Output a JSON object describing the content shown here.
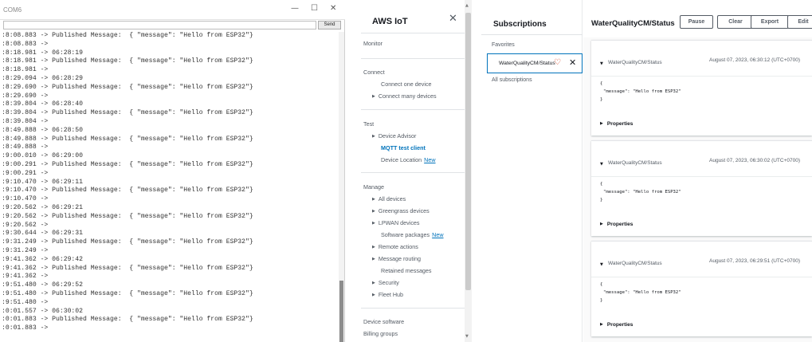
{
  "serial_monitor": {
    "title": "COM6",
    "send_label": "Send",
    "window_controls": [
      "—",
      "☐",
      "✕"
    ],
    "lines": [
      ":8:08.883 -> Published Message:  { \"message\": \"Hello from ESP32\"}",
      ":8:08.883 ->",
      ":8:18.981 -> 06:28:19",
      ":8:18.981 -> Published Message:  { \"message\": \"Hello from ESP32\"}",
      ":8:18.981 ->",
      ":8:29.094 -> 06:28:29",
      ":8:29.690 -> Published Message:  { \"message\": \"Hello from ESP32\"}",
      ":8:29.690 ->",
      ":8:39.804 -> 06:28:40",
      ":8:39.804 -> Published Message:  { \"message\": \"Hello from ESP32\"}",
      ":8:39.804 ->",
      ":8:49.888 -> 06:28:50",
      ":8:49.888 -> Published Message:  { \"message\": \"Hello from ESP32\"}",
      ":8:49.888 ->",
      ":9:00.010 -> 06:29:00",
      ":9:00.291 -> Published Message:  { \"message\": \"Hello from ESP32\"}",
      ":9:00.291 ->",
      ":9:10.470 -> 06:29:11",
      ":9:10.470 -> Published Message:  { \"message\": \"Hello from ESP32\"}",
      ":9:10.470 ->",
      ":9:20.562 -> 06:29:21",
      ":9:20.562 -> Published Message:  { \"message\": \"Hello from ESP32\"}",
      ":9:20.562 ->",
      ":9:30.644 -> 06:29:31",
      ":9:31.249 -> Published Message:  { \"message\": \"Hello from ESP32\"}",
      ":9:31.249 ->",
      ":9:41.362 -> 06:29:42",
      ":9:41.362 -> Published Message:  { \"message\": \"Hello from ESP32\"}",
      ":9:41.362 ->",
      ":9:51.480 -> 06:29:52",
      ":9:51.480 -> Published Message:  { \"message\": \"Hello from ESP32\"}",
      ":9:51.480 ->",
      ":0:01.557 -> 06:30:02",
      ":0:01.883 -> Published Message:  { \"message\": \"Hello from ESP32\"}",
      ":0:01.883 ->"
    ]
  },
  "nav": {
    "title": "AWS IoT",
    "close_icon": "✕",
    "monitor": "Monitor",
    "connect": {
      "heading": "Connect",
      "connect_one_device": "Connect one device",
      "connect_many_devices": "Connect many devices"
    },
    "test": {
      "heading": "Test",
      "device_advisor": "Device Advisor",
      "mqtt_test_client": "MQTT test client",
      "device_location": "Device Location",
      "new_badge": "New"
    },
    "manage": {
      "heading": "Manage",
      "all_devices": "All devices",
      "greengrass_devices": "Greengrass devices",
      "lpwan_devices": "LPWAN devices",
      "software_packages": "Software packages",
      "new_badge": "New",
      "remote_actions": "Remote actions",
      "message_routing": "Message routing",
      "retained_messages": "Retained messages",
      "security": "Security",
      "fleet_hub": "Fleet Hub"
    },
    "device_software": "Device software",
    "billing_groups": "Billing groups"
  },
  "subscriptions": {
    "title": "Subscriptions",
    "favorites_label": "Favorites",
    "favorite_topic": "WaterQualityCM/Status",
    "all_subscriptions_label": "All subscriptions"
  },
  "topic_panel": {
    "title": "WaterQualityCM/Status",
    "buttons": {
      "pause": "Pause",
      "clear": "Clear",
      "export": "Export",
      "edit": "Edit"
    },
    "messages": [
      {
        "topic": "WaterQualityCM/Status",
        "timestamp": "August 07, 2023, 06:30:12 (UTC+0700)",
        "payload_open": "{",
        "payload_body": "\"message\": \"Hello from ESP32\"",
        "payload_close": "}",
        "properties_label": "Properties"
      },
      {
        "topic": "WaterQualityCM/Status",
        "timestamp": "August 07, 2023, 06:30:02 (UTC+0700)",
        "payload_open": "{",
        "payload_body": "\"message\": \"Hello from ESP32\"",
        "payload_close": "}",
        "properties_label": "Properties"
      },
      {
        "topic": "WaterQualityCM/Status",
        "timestamp": "August 07, 2023, 06:29:51 (UTC+0700)",
        "payload_open": "{",
        "payload_body": "\"message\": \"Hello from ESP32\"",
        "payload_close": "}",
        "properties_label": "Properties"
      }
    ]
  },
  "colors": {
    "link_blue": "#0073bb",
    "text_dark": "#16191f",
    "text_muted": "#545b64",
    "heart_red": "#d13212"
  }
}
